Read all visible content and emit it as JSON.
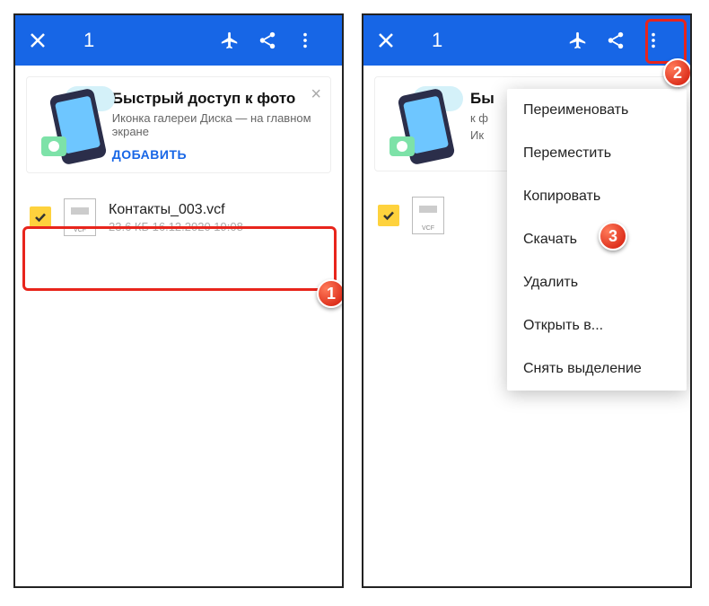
{
  "topbar": {
    "selection_count": "1"
  },
  "promo": {
    "title": "Быстрый доступ к фото",
    "subtitle": "Иконка галереи Диска — на главном экране",
    "action": "ДОБАВИТЬ",
    "title_cropped": "Бы",
    "subtitle_cropped": "к ф",
    "subtitle2_cropped": "Ик"
  },
  "file": {
    "name": "Контакты_003.vcf",
    "meta": "23.6 КБ 16.12.2020 19:08",
    "ext_label": "VCF"
  },
  "menu": {
    "rename": "Переименовать",
    "move": "Переместить",
    "copy": "Копировать",
    "download": "Скачать",
    "delete": "Удалить",
    "open_in": "Открыть в...",
    "deselect": "Снять выделение"
  },
  "markers": {
    "m1": "1",
    "m2": "2",
    "m3": "3"
  }
}
